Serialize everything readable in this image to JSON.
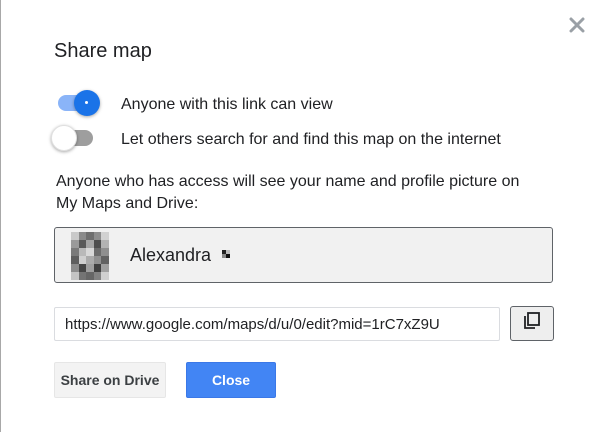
{
  "dialog": {
    "title": "Share map",
    "close_icon": "close-icon",
    "toggles": [
      {
        "label": "Anyone with this link can view",
        "checked": true
      },
      {
        "label": "Let others search for and find this map on the internet",
        "checked": false
      }
    ],
    "info_text": "Anyone who has access will see your name and profile picture on My Maps and Drive:",
    "owner": {
      "name": "Alexandra",
      "avatar_icon": "pixelated-avatar"
    },
    "share_link": {
      "value": "https://www.google.com/maps/d/u/0/edit?mid=1rC7xZ9U"
    },
    "copy_icon": "copy-icon",
    "buttons": {
      "share_on_drive": "Share on Drive",
      "close": "Close"
    }
  },
  "colors": {
    "accent": "#1a73e8",
    "primary_button": "#4285f4",
    "toggle_track_on": "#8ab4f8",
    "toggle_track_off": "#9e9e9e"
  }
}
